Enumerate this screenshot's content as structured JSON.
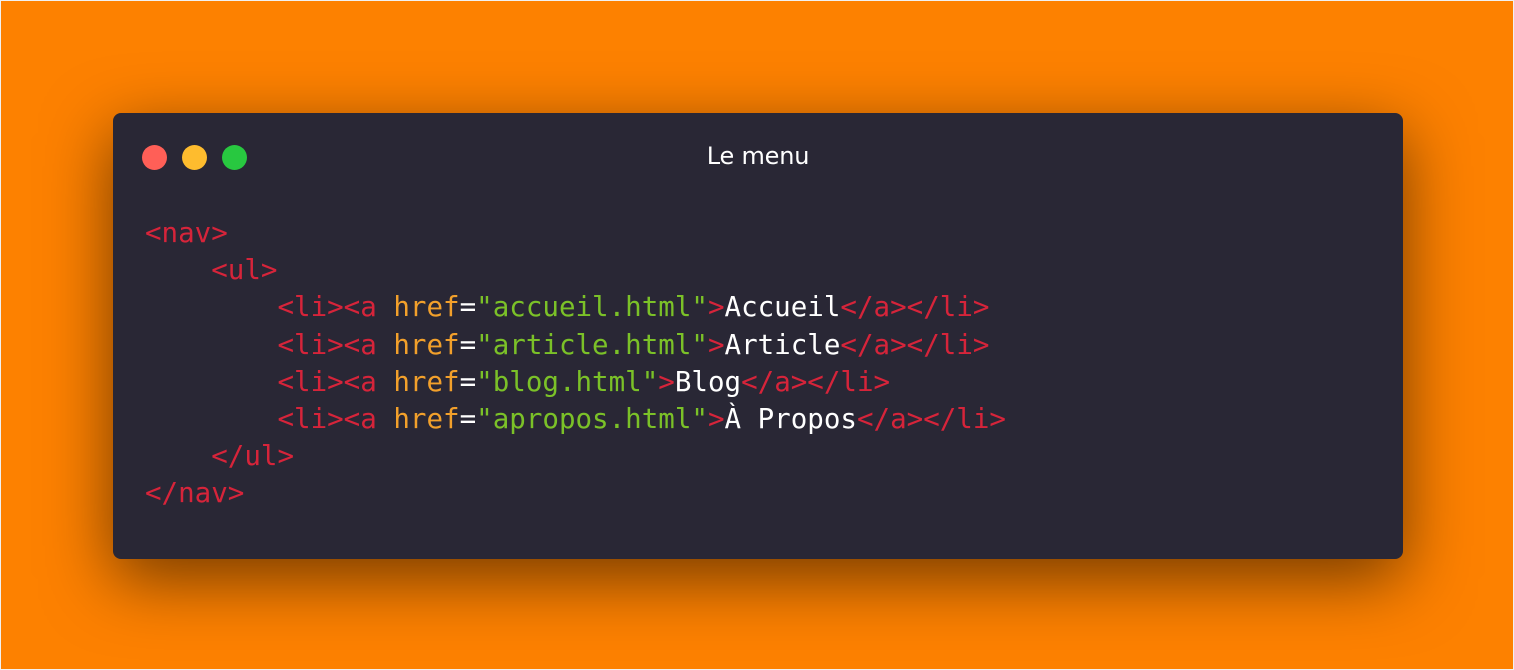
{
  "colors": {
    "background": "#fd8100",
    "window": "#292735",
    "title": "#ffffff",
    "tag": "#d6243a",
    "attr": "#f2a02b",
    "string": "#7bc128",
    "plain": "#ffffff",
    "close": "#ff5f57",
    "minimize": "#febc2e",
    "zoom": "#28c840"
  },
  "window": {
    "title": "Le menu",
    "controls": [
      {
        "name": "close-button",
        "color": "#ff5f57"
      },
      {
        "name": "minimize-button",
        "color": "#febc2e"
      },
      {
        "name": "zoom-button",
        "color": "#28c840"
      }
    ]
  },
  "code": {
    "language": "html",
    "lines": [
      [
        {
          "t": "<nav>",
          "c": "tag"
        }
      ],
      [
        {
          "t": "    ",
          "c": "plain"
        },
        {
          "t": "<ul>",
          "c": "tag"
        }
      ],
      [
        {
          "t": "        ",
          "c": "plain"
        },
        {
          "t": "<li><a ",
          "c": "tag"
        },
        {
          "t": "href",
          "c": "attr"
        },
        {
          "t": "=",
          "c": "plain"
        },
        {
          "t": "\"accueil.html\"",
          "c": "string"
        },
        {
          "t": ">",
          "c": "tag"
        },
        {
          "t": "Accueil",
          "c": "plain"
        },
        {
          "t": "</a></li>",
          "c": "tag"
        }
      ],
      [
        {
          "t": "        ",
          "c": "plain"
        },
        {
          "t": "<li><a ",
          "c": "tag"
        },
        {
          "t": "href",
          "c": "attr"
        },
        {
          "t": "=",
          "c": "plain"
        },
        {
          "t": "\"article.html\"",
          "c": "string"
        },
        {
          "t": ">",
          "c": "tag"
        },
        {
          "t": "Article",
          "c": "plain"
        },
        {
          "t": "</a></li>",
          "c": "tag"
        }
      ],
      [
        {
          "t": "        ",
          "c": "plain"
        },
        {
          "t": "<li><a ",
          "c": "tag"
        },
        {
          "t": "href",
          "c": "attr"
        },
        {
          "t": "=",
          "c": "plain"
        },
        {
          "t": "\"blog.html\"",
          "c": "string"
        },
        {
          "t": ">",
          "c": "tag"
        },
        {
          "t": "Blog",
          "c": "plain"
        },
        {
          "t": "</a></li>",
          "c": "tag"
        }
      ],
      [
        {
          "t": "        ",
          "c": "plain"
        },
        {
          "t": "<li><a ",
          "c": "tag"
        },
        {
          "t": "href",
          "c": "attr"
        },
        {
          "t": "=",
          "c": "plain"
        },
        {
          "t": "\"apropos.html\"",
          "c": "string"
        },
        {
          "t": ">",
          "c": "tag"
        },
        {
          "t": "À Propos",
          "c": "plain"
        },
        {
          "t": "</a></li>",
          "c": "tag"
        }
      ],
      [
        {
          "t": "    ",
          "c": "plain"
        },
        {
          "t": "</ul>",
          "c": "tag"
        }
      ],
      [
        {
          "t": "</nav>",
          "c": "tag"
        }
      ]
    ]
  }
}
